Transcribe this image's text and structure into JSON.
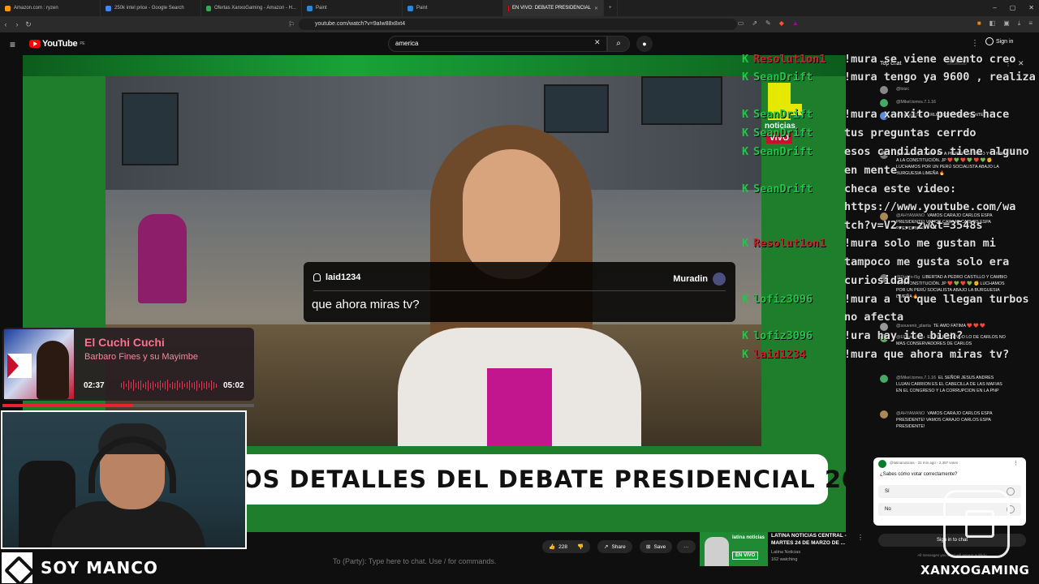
{
  "browser": {
    "tabs": [
      {
        "label": "Amazon.com : ryzen",
        "color": "#ff9900",
        "active": false
      },
      {
        "label": "250k intel price - Google Search",
        "color": "#4285f4",
        "active": false
      },
      {
        "label": "Ofertas XanxoGaming - Amazon - H...",
        "color": "#34a853",
        "active": false
      },
      {
        "label": "Paint",
        "color": "#2b88d8",
        "active": false
      },
      {
        "label": "Paint",
        "color": "#2b88d8",
        "active": false
      },
      {
        "label": "EN VIVO: DEBATE PRESIDENCIAL",
        "color": "#ff0000",
        "active": true
      }
    ],
    "new_tab": "+",
    "url": "youtube.com/watch?v=9aIw88x8xt4"
  },
  "youtube": {
    "logo_text": "YouTube",
    "region": "PE",
    "search_value": "america",
    "signin_label": "Sign in"
  },
  "video": {
    "lower_third": "OS DETALLES DEL DEBATE PRESIDENCIAL 2026",
    "channel_logo_text": "noticias",
    "live_badge": "VIVO"
  },
  "bubble": {
    "user": "laid1234",
    "target": "Muradin",
    "message": "que ahora miras tv?"
  },
  "overlay_chat": [
    {
      "name": "Resolut1on1",
      "color": "#c8252b",
      "text": "!mura se viene evento creo"
    },
    {
      "name": "SeanDrift",
      "color": "#22c54a",
      "text": "!mura tengo ya 9600 , realiza"
    },
    {
      "name": "SeanDrift",
      "color": "#22c54a",
      "text": "tus preguntas cerrdo"
    },
    {
      "name": "Resolut1on1",
      "color": "#c8252b",
      "text": "!mura xanxito puedes hace"
    },
    {
      "name": "SeanDrift",
      "color": "#22c54a",
      "text": "!mura xanxito puedes hace"
    },
    {
      "name": "SeanDrift",
      "color": "#22c54a",
      "text": "esos candidatos tiene alguno"
    },
    {
      "name": "SeanDrift",
      "color": "#22c54a",
      "text": "checa este video:"
    },
    {
      "name": "Resolut1on1",
      "color": "#c8252b",
      "text": "!mura solo me gustan mi"
    },
    {
      "name": "lofiz3096",
      "color": "#22c54a",
      "text": "!mura a lo que llegan turbos"
    },
    {
      "name": "lofiz3096",
      "color": "#22c54a",
      "text": "!ura hay ite bien?"
    },
    {
      "name": "laid1234",
      "color": "#c8252b",
      "text": "!mura que ahora miras tv?"
    }
  ],
  "overlay_wraps": [
    "en mente",
    "https://www.youtube.com/wa",
    "tch?v=V2...zw&t=3548s",
    "tampoco me gusta solo era",
    "curiosidad",
    "no afecta"
  ],
  "yt_chat": {
    "mode": "Top chat",
    "top_fans": "Top fans",
    "messages": [
      {
        "author": "@loizc",
        "text": "",
        "av": "#888"
      },
      {
        "author": "@Mikel.torres.7.1.16",
        "text": "",
        "av": "#4a6"
      },
      {
        "author": "@marito1755",
        "text": "CARLOS ESPÁ PRESIDENTE",
        "av": "#5a8de0"
      },
      {
        "author": "@Diablo-l5g",
        "text": "LIBERTAD A PEDRO CASTILLO Y CAMBIO A LA CONSTITUCIÓN. JP ❤️ 💚 ❤️ 💚 ❤️ 💚 ✊ LUCHAMOS POR UN PERÚ SOCIALISTA ABAJO LA BURGUESIA LIMEÑA 🔥",
        "av": "#777"
      },
      {
        "author": "@AHYAMANO",
        "text": "VAMOS CARAJO CARLOS ESPA PRESIDENTE! VAMOS CARAJO CARLOS ESPA PRESIDENTE!",
        "av": "#a85"
      },
      {
        "author": "@Diablo-l5g",
        "text": "LIBERTAD A PEDRO CASTILLO Y CAMBIO A LA CONSTITUCIÓN. JP ❤️ 💚 ❤️ 💚 ✊ LUCHAMOS POR UN PERÚ SOCIALISTA ABAJO LA BURGUESIA LIMEÑA 🔥",
        "av": "#777"
      },
      {
        "author": "@souvenir_planta",
        "text": "TE AMO FATIMA ❤️ ❤️ ❤️",
        "av": "#999"
      },
      {
        "author": "@ElDerechista",
        "text": "ESTAS HACIENDO LO DE CARLOS NO MAS CONSERVADORES DE CARLOS",
        "av": "#6a6"
      },
      {
        "author": "@Mikel.torres.7.1.16",
        "text": "EL SEÑOR JESUS ANDRES LUJAN CARRION ES EL CABECILLA DE LAS MAFIAS EN EL CONGRESO Y LA CORRUPCION EN LA PNP",
        "av": "#4a6"
      },
      {
        "author": "@AHYAMANO",
        "text": "VAMOS CARAJO CARLOS ESPA PRESIDENTE! VAMOS CARAJO CARLOS ESPA PRESIDENTE!",
        "av": "#a85"
      }
    ],
    "poll": {
      "meta": "@latinanoticias · 31 min ago · 2,397 votes",
      "question": "¿Sabes cómo votar correctamente?",
      "options": [
        "Sí",
        "No"
      ]
    },
    "signin_label": "Sign in to chat",
    "footer": "All messages you send will appear publicly"
  },
  "below_video": {
    "likes": "228",
    "share_label": "Share",
    "save_label": "Save",
    "more_label": "···",
    "card_title": "LATINA NOTICIAS CENTRAL - MARTES 24 DE MARZO DE ...",
    "card_channel": "Latina Noticias",
    "card_watching": "162 watching",
    "card_thumb_logo": "latina noticias",
    "card_thumb_badge": "EN VIVO",
    "chat_input_text": "To (Party): Type here to chat. Use / for commands."
  },
  "music": {
    "title": "El Cuchi Cuchi",
    "artist": "Barbaro Fines y su Mayimbe",
    "current": "02:37",
    "duration": "05:02",
    "progress": 0.52
  },
  "branding": {
    "left": "SOY MANCO",
    "right": "XANXOGAMING"
  }
}
